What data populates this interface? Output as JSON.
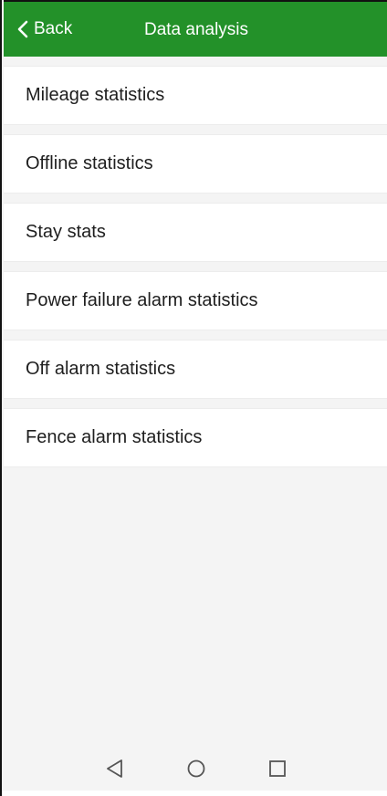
{
  "header": {
    "back_label": "Back",
    "title": "Data analysis",
    "background": "#239129",
    "back_icon": "chevron-left-icon"
  },
  "menu": {
    "items": [
      {
        "label": "Mileage statistics"
      },
      {
        "label": "Offline statistics"
      },
      {
        "label": "Stay stats"
      },
      {
        "label": "Power failure alarm statistics"
      },
      {
        "label": "Off alarm statistics"
      },
      {
        "label": "Fence alarm statistics"
      }
    ]
  },
  "navbar": {
    "back_icon": "triangle-back-icon",
    "home_icon": "circle-home-icon",
    "recent_icon": "square-recents-icon"
  }
}
